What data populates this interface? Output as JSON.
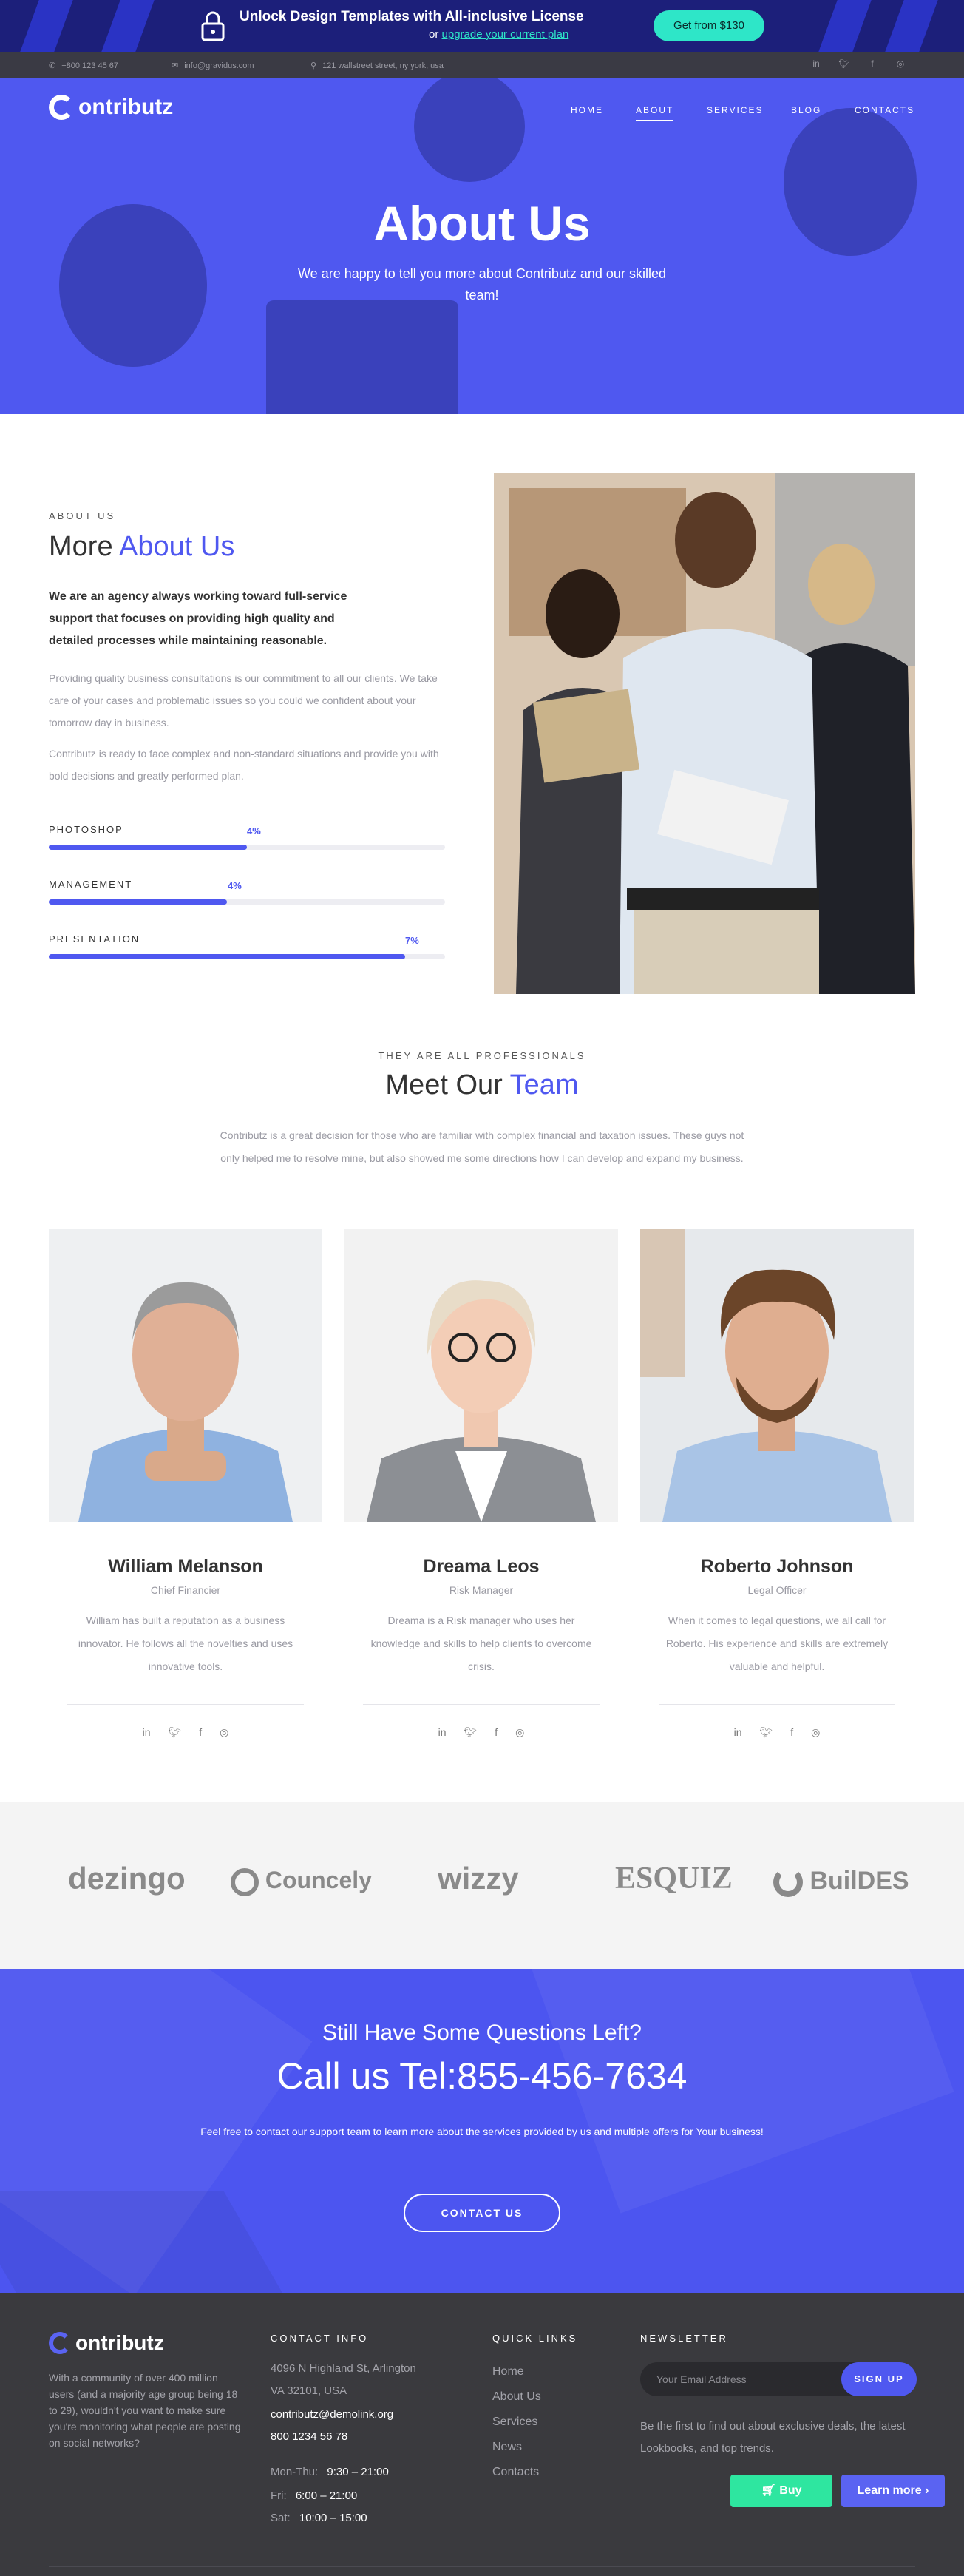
{
  "promo": {
    "title": "Unlock Design Templates with All-inclusive License",
    "sub_prefix": "or",
    "sub_link": "upgrade your current plan",
    "button": "Get from $130"
  },
  "infobar": {
    "phone": "+800 123 45 67",
    "email": "info@gravidus.com",
    "address": "121 wallstreet street, ny york, usa",
    "social": [
      "linkedin-icon",
      "twitter-icon",
      "facebook-icon",
      "instagram-icon"
    ]
  },
  "brand": {
    "name": "ontributz"
  },
  "nav": {
    "items": [
      "HOME",
      "ABOUT",
      "SERVICES",
      "BLOG",
      "CONTACTS"
    ],
    "active": "ABOUT"
  },
  "hero": {
    "title": "About Us",
    "subtitle": "We are happy to tell you more about Contributz and our skilled team!"
  },
  "about": {
    "kicker": "ABOUT US",
    "title_plain": "More",
    "title_accent": "About Us",
    "lead": "We are an agency always working toward full-service support that focuses on providing high quality and detailed processes while maintaining reasonable.",
    "p1": "Providing quality business consultations is our commitment to all our clients. We take care of your cases and problematic issues so you could we confident about your tomorrow day in business.",
    "p2": "Contributz is ready to face complex and non-standard situations and provide you with bold decisions and greatly performed plan.",
    "skills": [
      {
        "label": "PHOTOSHOP",
        "value": "4%",
        "fraction": 0.5
      },
      {
        "label": "MANAGEMENT",
        "value": "4%",
        "fraction": 0.45
      },
      {
        "label": "PRESENTATION",
        "value": "7%",
        "fraction": 0.9
      }
    ]
  },
  "team": {
    "kicker": "THEY ARE ALL PROFESSIONALS",
    "title_plain": "Meet Our",
    "title_accent": "Team",
    "desc": "Contributz is a great decision for those who are familiar with complex financial and taxation issues. These guys not only helped me to resolve mine, but also showed me some directions how I can develop and expand my business.",
    "members": [
      {
        "name": "William Melanson",
        "role": "Chief Financier",
        "desc": "William has built a reputation as a business innovator. He follows all the novelties and uses innovative tools."
      },
      {
        "name": "Dreama Leos",
        "role": "Risk Manager",
        "desc": "Dreama is a Risk manager who uses her knowledge and skills to help clients to overcome crisis."
      },
      {
        "name": "Roberto Johnson",
        "role": "Legal Officer",
        "desc": "When it comes to legal questions, we all call for Roberto. His experience and skills are extremely valuable and helpful."
      }
    ],
    "social": [
      "linkedin-icon",
      "twitter-icon",
      "facebook-icon",
      "instagram-icon"
    ]
  },
  "brands": [
    "dezingo",
    "Councely",
    "wizzy",
    "ESQUIZ",
    "BuilDES"
  ],
  "cta": {
    "kicker": "Still Have Some Questions Left?",
    "title": "Call us Tel:855-456-7634",
    "text": "Feel free to contact our support team to learn more about the services provided by us and multiple offers for Your business!",
    "button": "CONTACT US"
  },
  "footer": {
    "about": "With a community of over 400 million users (and a  majority age group being 18 to 29), wouldn't you want to make sure you're monitoring what people are posting on social networks?",
    "contact_heading": "CONTACT INFO",
    "address1": "4096 N Highland St, Arlington",
    "address2": "VA 32101, USA",
    "email": "contributz@demolink.org",
    "phone": "800 1234 56 78",
    "hours": [
      {
        "day": "Mon-Thu:",
        "time": "9:30 – 21:00"
      },
      {
        "day": "Fri:",
        "time": "6:00 – 21:00"
      },
      {
        "day": "Sat:",
        "time": "10:00 – 15:00"
      }
    ],
    "links_heading": "QUICK LINKS",
    "links": [
      "Home",
      "About Us",
      "Services",
      "News",
      "Contacts"
    ],
    "newsletter_heading": "NEWSLETTER",
    "email_placeholder": "Your Email Address",
    "signup": "SIGN UP",
    "newsletter_text": "Be the first to find out about exclusive deals, the latest Lookbooks, and top trends.",
    "buy": "Buy",
    "learn": "Learn more"
  },
  "colors": {
    "accent": "#4f58f0",
    "promo_bg": "#1c1f7a",
    "promo_btn": "#2ee6c8",
    "footer_bg": "#3a3a3e"
  }
}
